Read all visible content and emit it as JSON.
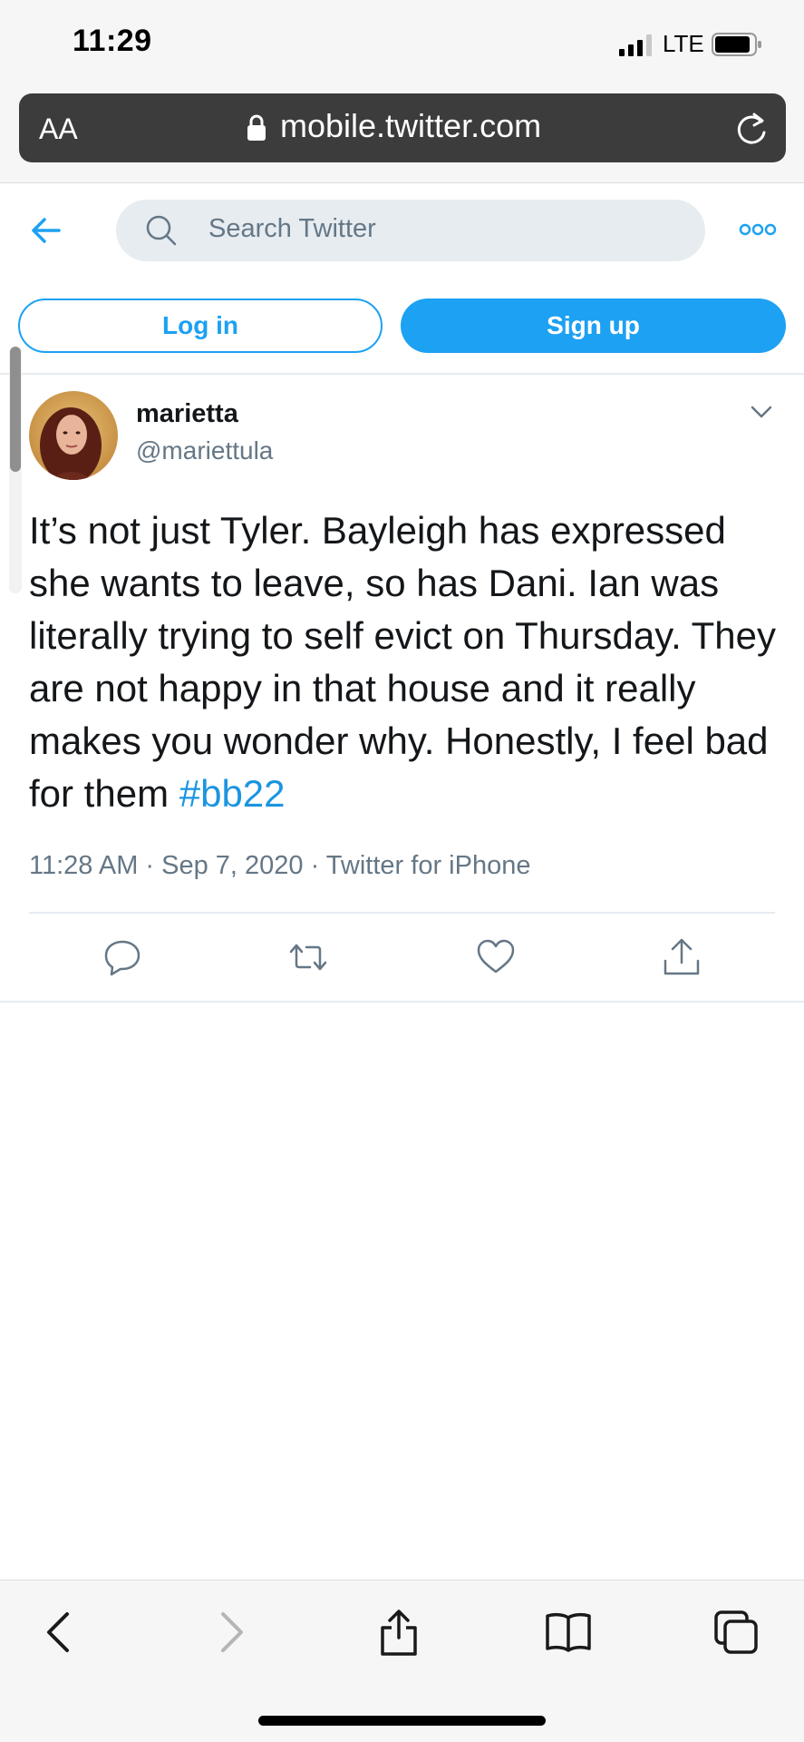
{
  "status_bar": {
    "time": "11:29",
    "network": "LTE"
  },
  "browser": {
    "text_size_label": "AA",
    "url": "mobile.twitter.com",
    "icons": [
      "lock-icon",
      "reload-icon",
      "back-icon",
      "forward-icon",
      "share-icon",
      "bookmarks-icon",
      "tabs-icon"
    ]
  },
  "header": {
    "search_placeholder": "Search Twitter",
    "login_label": "Log in",
    "signup_label": "Sign up"
  },
  "tweet": {
    "display_name": "marietta",
    "handle": "@mariettula",
    "text": "It’s not just Tyler. Bayleigh has expressed she wants to leave, so has Dani. Ian was literally trying to self evict on Thursday. They are not happy in that house and it really makes you wonder why. Honestly, I feel bad for them ",
    "hashtag": "#bb22",
    "meta": "11:28 AM · Sep 7, 2020 · Twitter for iPhone",
    "actions": [
      "reply-icon",
      "retweet-icon",
      "like-icon",
      "share-icon"
    ]
  },
  "colors": {
    "twitter_blue": "#1da1f2",
    "hashtag_blue": "#1b95e0",
    "secondary_text": "#657786",
    "url_bar": "#3c3c3c"
  }
}
